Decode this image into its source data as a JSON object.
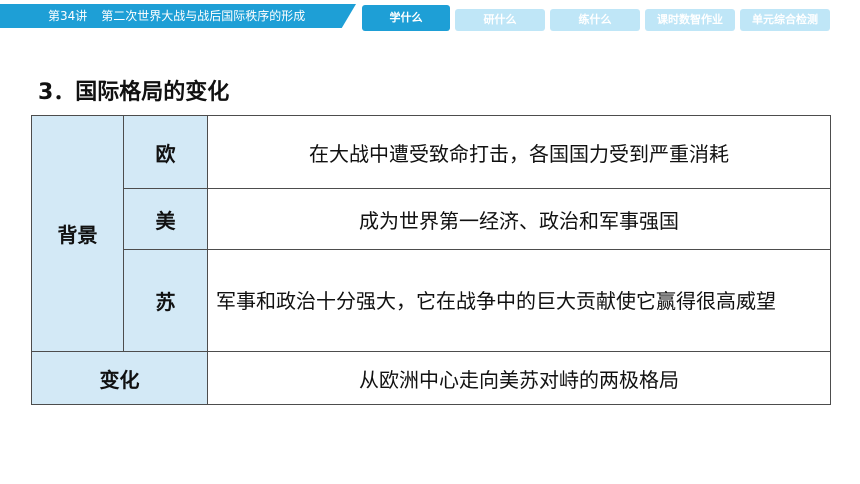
{
  "header": {
    "lesson_number": "第34讲",
    "lesson_title": "第二次世界大战与战后国际秩序的形成",
    "tabs": [
      {
        "label": "学什么",
        "active": true
      },
      {
        "label": "研什么",
        "active": false
      },
      {
        "label": "练什么",
        "active": false
      },
      {
        "label": "课时数智作业",
        "active": false
      },
      {
        "label": "单元综合检测",
        "active": false
      }
    ]
  },
  "section": {
    "title": "3．国际格局的变化"
  },
  "table": {
    "background_label": "背景",
    "rows": [
      {
        "region": "欧",
        "text": "在大战中遭受致命打击，各国国力受到严重消耗"
      },
      {
        "region": "美",
        "text": "成为世界第一经济、政治和军事强国"
      },
      {
        "region": "苏",
        "text": "军事和政治十分强大，它在战争中的巨大贡献使它赢得很高威望"
      }
    ],
    "change_label": "变化",
    "change_text": "从欧洲中心走向美苏对峙的两极格局"
  },
  "colors": {
    "accent": "#1e9fd6",
    "tab_inactive": "#bfe6f7",
    "header_cell": "#d3e9f6",
    "border": "#4d4d4d"
  }
}
